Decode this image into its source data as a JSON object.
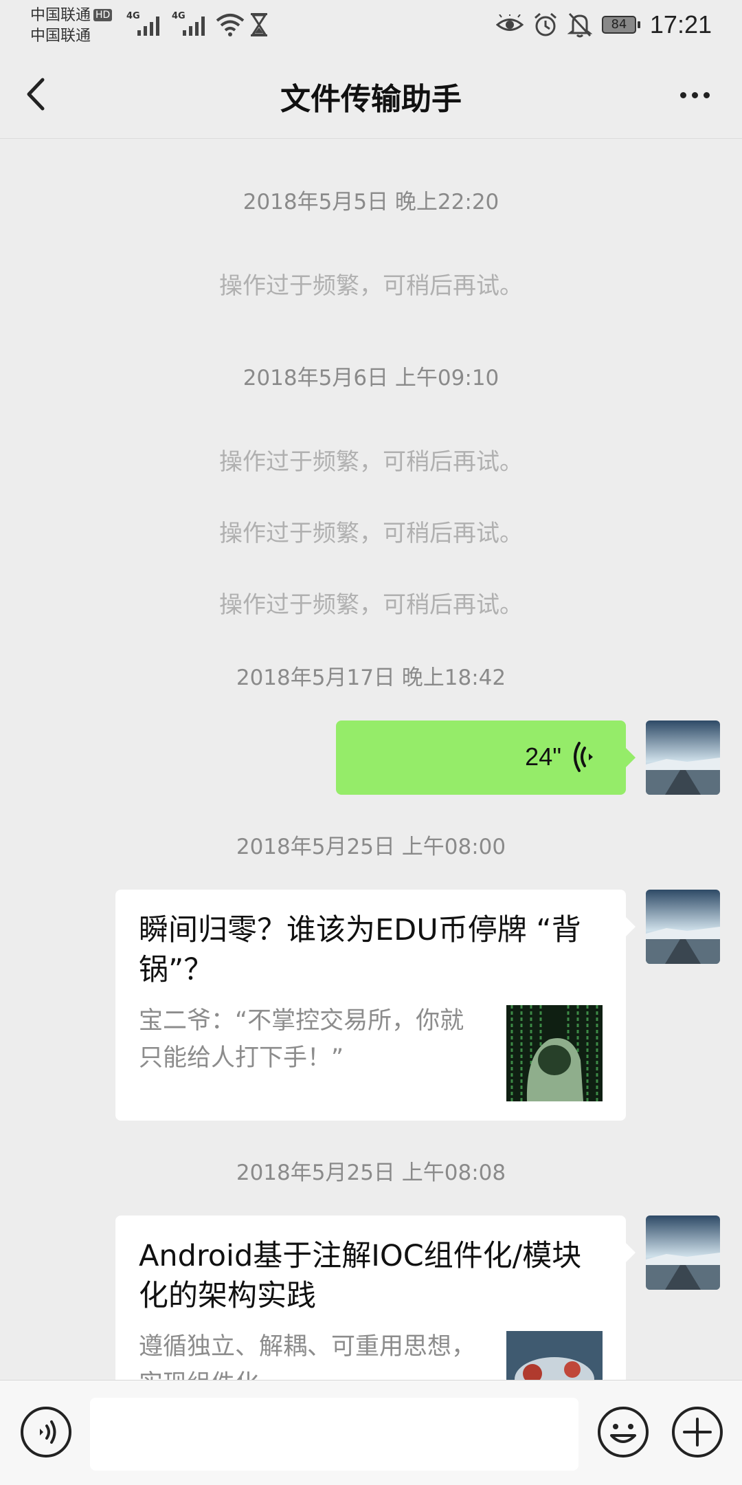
{
  "status_bar": {
    "carrier_1": "中国联通",
    "carrier_1_badge": "HD",
    "carrier_2": "中国联通",
    "network_1": "4G",
    "network_2": "4G",
    "battery_level": "84",
    "time": "17:21"
  },
  "header": {
    "title": "文件传输助手"
  },
  "messages": {
    "ts_1": "2018年5月5日 晚上22:20",
    "sys_1": "操作过于频繁，可稍后再试。",
    "ts_2": "2018年5月6日 上午09:10",
    "sys_2": "操作过于频繁，可稍后再试。",
    "sys_3": "操作过于频繁，可稍后再试。",
    "sys_4": "操作过于频繁，可稍后再试。",
    "ts_3": "2018年5月17日 晚上18:42",
    "voice_duration": "24\"",
    "ts_4": "2018年5月25日 上午08:00",
    "card_1": {
      "title": "瞬间归零？谁该为EDU币停牌 “背锅”？",
      "desc": "宝二爷：“不掌控交易所，你就只能给人打下手！”"
    },
    "ts_5": "2018年5月25日 上午08:08",
    "card_2": {
      "title": "Android基于注解IOC组件化/模块化的架构实践",
      "desc": "遵循独立、解耦、可重用思想，实现组件化"
    }
  },
  "colors": {
    "background": "#EDEDED",
    "voice_bubble": "#95EC69",
    "card": "#FFFFFF",
    "input_bar": "#F7F7F7"
  },
  "icons": [
    "back-arrow-icon",
    "more-icon",
    "voice-wave-icon",
    "voice-mode-icon",
    "emoji-icon",
    "plus-icon",
    "wifi-icon",
    "eye-icon",
    "alarm-icon",
    "mute-icon",
    "hourglass-icon"
  ]
}
